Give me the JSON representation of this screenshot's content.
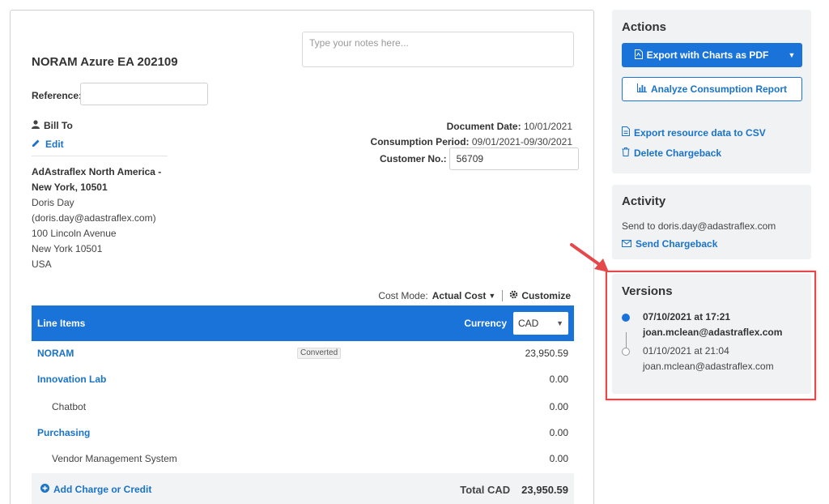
{
  "document": {
    "title": "NORAM Azure EA 202109",
    "notes_placeholder": "Type your notes here...",
    "reference_label": "Reference:",
    "reference_value": "",
    "bill_to_label": "Bill To",
    "edit_label": "Edit",
    "address": {
      "company_line1": "AdAstraflex North America -",
      "company_line2": "New York, 10501",
      "contact": "Doris Day",
      "email": "(doris.day@adastraflex.com)",
      "street": "100 Lincoln Avenue",
      "city": "New York 10501",
      "country": "USA"
    },
    "meta": {
      "document_date_label": "Document Date:",
      "document_date": "10/01/2021",
      "consumption_period_label": "Consumption Period:",
      "consumption_period": "09/01/2021-09/30/2021",
      "customer_no_label": "Customer No.:",
      "customer_no": "56709"
    },
    "cost_mode": {
      "label": "Cost Mode:",
      "value": "Actual Cost",
      "customize_label": "Customize"
    },
    "line_items": {
      "header_title": "Line Items",
      "currency_label": "Currency",
      "currency_value": "CAD",
      "rows": [
        {
          "name": "NORAM",
          "badge": "Converted",
          "amount": "23,950.59"
        },
        {
          "name": "Innovation Lab",
          "badge": "",
          "amount": "0.00"
        },
        {
          "name": "Chatbot",
          "badge": "",
          "amount": "0.00"
        },
        {
          "name": "Purchasing",
          "badge": "",
          "amount": "0.00"
        },
        {
          "name": "Vendor Management System",
          "badge": "",
          "amount": "0.00"
        }
      ],
      "add_charge_label": "Add Charge or Credit",
      "total_label": "Total CAD",
      "total_value": "23,950.59"
    }
  },
  "actions": {
    "title": "Actions",
    "export_pdf_label": "Export with Charts as PDF",
    "analyze_label": "Analyze Consumption Report",
    "export_csv_label": "Export resource data to CSV",
    "delete_label": "Delete Chargeback"
  },
  "activity": {
    "title": "Activity",
    "send_to_text": "Send to doris.day@adastraflex.com",
    "send_label": "Send Chargeback"
  },
  "versions": {
    "title": "Versions",
    "items": [
      {
        "date": "07/10/2021 at 17:21",
        "user": "joan.mclean@adastraflex.com",
        "current": true
      },
      {
        "date": "01/10/2021 at 21:04",
        "user": "joan.mclean@adastraflex.com",
        "current": false
      }
    ]
  },
  "colors": {
    "accent": "#1a73d9",
    "link": "#1a73c8",
    "highlight": "#e4484a",
    "panel_bg": "#f0f2f4"
  }
}
